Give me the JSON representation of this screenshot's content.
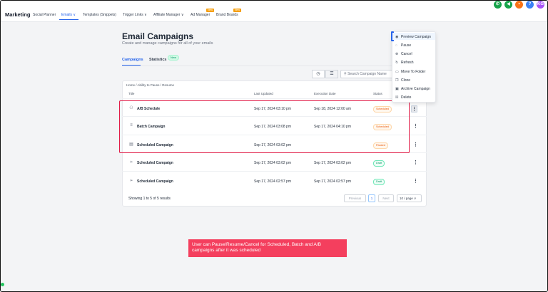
{
  "nav": {
    "brand": "Marketing",
    "items": [
      {
        "label": "Social Planner"
      },
      {
        "label": "Emails ∨"
      },
      {
        "label": "Templates (Snippets)"
      },
      {
        "label": "Trigger Links ∨"
      },
      {
        "label": "Affiliate Manager ∨"
      },
      {
        "label": "Ad Manager"
      },
      {
        "label": "Brand Boards"
      }
    ],
    "badges": [
      "New",
      "New"
    ],
    "top_icons": [
      {
        "icon": "phone-icon",
        "glyph": "✆",
        "color": "#16a34a"
      },
      {
        "icon": "megaphone-icon",
        "glyph": "◀",
        "color": "#16a34a"
      },
      {
        "icon": "bell-icon",
        "glyph": "•",
        "color": "#f97316"
      },
      {
        "icon": "help-icon",
        "glyph": "?",
        "color": "#3b82f6"
      },
      {
        "icon": "avatar",
        "glyph": "KG",
        "color": "#a855f7"
      }
    ]
  },
  "page": {
    "title": "Email Campaigns",
    "subtitle": "Create and manage campaigns for all of your emails",
    "tabs": [
      {
        "label": "Campaigns"
      },
      {
        "label": "Statistics"
      }
    ],
    "new_badge": "New",
    "search_placeholder": "Search Campaign Name"
  },
  "table": {
    "breadcrumb": "Home  /  Ability to Pause / Resume",
    "headers": [
      "Title",
      "Last Updated",
      "Execution Date",
      "Status"
    ],
    "rows": [
      {
        "icon": "ab-test-icon",
        "glyph": "⚇",
        "name": "A/B Schedule",
        "updated": "Sep 17, 2024 03:10 pm",
        "execution": "Sep 18, 2024 12:00 am",
        "status": "Scheduled",
        "kind": "scheduled"
      },
      {
        "icon": "batch-icon",
        "glyph": "≡",
        "name": "Batch Campaign",
        "updated": "Sep 17, 2024 03:08 pm",
        "execution": "Sep 17, 2024 04:10 pm",
        "status": "Scheduled",
        "kind": "scheduled"
      },
      {
        "icon": "calendar-icon",
        "glyph": "▤",
        "name": "Scheduled Campaign",
        "updated": "Sep 17, 2024 03:02 pm",
        "execution": "",
        "status": "Paused",
        "kind": "paused"
      },
      {
        "icon": "send-icon",
        "glyph": "➢",
        "name": "Scheduled Campaign",
        "updated": "Sep 17, 2024 03:02 pm",
        "execution": "Sep 17, 2024 03:02 pm",
        "status": "Draft",
        "kind": "draft"
      },
      {
        "icon": "send-icon",
        "glyph": "➢",
        "name": "Scheduled Campaign",
        "updated": "Sep 17, 2024 02:57 pm",
        "execution": "Sep 17, 2024 02:57 pm",
        "status": "Draft",
        "kind": "draft"
      }
    ],
    "footer": "Showing 1 to 5 of 5 results",
    "pagination": {
      "previous": "Previous",
      "current": "1",
      "next": "Next",
      "per_page": "10 / page  ∨"
    }
  },
  "dropdown": {
    "items": [
      {
        "icon": "eye-icon",
        "glyph": "◉",
        "label": "Preview Campaign"
      },
      {
        "icon": "pause-icon",
        "glyph": "◌",
        "label": "Pause"
      },
      {
        "icon": "cancel-icon",
        "glyph": "⊗",
        "label": "Cancel"
      },
      {
        "icon": "refresh-icon",
        "glyph": "↻",
        "label": "Refresh"
      },
      {
        "icon": "folder-icon",
        "glyph": "▭",
        "label": "Move To Folder"
      },
      {
        "icon": "clone-icon",
        "glyph": "❐",
        "label": "Clone"
      },
      {
        "icon": "archive-icon",
        "glyph": "▣",
        "label": "Archive Campaign"
      },
      {
        "icon": "trash-icon",
        "glyph": "☒",
        "label": "Delete"
      }
    ]
  },
  "callout": "User can Pause/Resume/Cancel for Scheduled, Batch and A/B campaigns after it was scheduled",
  "colors": {
    "accent": "#2563eb",
    "highlight": "#e11d48",
    "callout": "#f43f5e"
  }
}
